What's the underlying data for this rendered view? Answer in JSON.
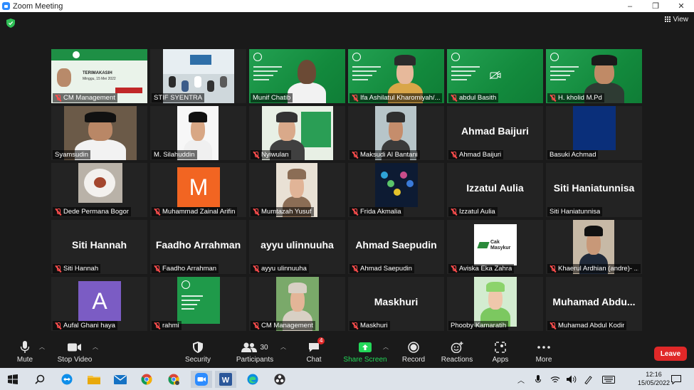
{
  "window": {
    "title": "Zoom Meeting",
    "min": "–",
    "max": "❐",
    "close": "✕"
  },
  "view_label": "View",
  "slide_text": {
    "title": "TERIMAKASIH",
    "date": "Minggu, 15 Mei 2022"
  },
  "participants": [
    {
      "name": "CM Management",
      "muted": true,
      "kind": "slide-cm",
      "active": true
    },
    {
      "name": "STIF SYENTRA",
      "muted": false,
      "kind": "room"
    },
    {
      "name": "Munif Chatib",
      "muted": false,
      "kind": "slide-person"
    },
    {
      "name": "Ifa Ashilatul Kharomiyah/...",
      "muted": true,
      "kind": "slide-person2"
    },
    {
      "name": "abdul Basith",
      "muted": true,
      "kind": "slide-camoff"
    },
    {
      "name": "H. kholid M.Pd",
      "muted": true,
      "kind": "slide-person3"
    },
    {
      "name": "Syamsudin",
      "muted": false,
      "kind": "person-cap"
    },
    {
      "name": "M. Silahuddin",
      "muted": false,
      "kind": "person-white"
    },
    {
      "name": "Nyiwulan",
      "muted": true,
      "kind": "person-hijab-slide"
    },
    {
      "name": "Maksudi Al Bantani",
      "muted": true,
      "kind": "person-outdoor"
    },
    {
      "name": "Ahmad Baijuri",
      "muted": true,
      "kind": "name",
      "display": "Ahmad Baijuri"
    },
    {
      "name": "Basuki Achmad",
      "muted": false,
      "kind": "blue-square"
    },
    {
      "name": "Dede Permana Bogor",
      "muted": true,
      "kind": "plate"
    },
    {
      "name": "Muhammad Zainal Arifin",
      "muted": true,
      "kind": "letter",
      "letter": "M",
      "color": "#f26522"
    },
    {
      "name": "Mumtazah Yusuf",
      "muted": true,
      "kind": "person-hijab"
    },
    {
      "name": "Frida Akmalia",
      "muted": true,
      "kind": "space"
    },
    {
      "name": "Izzatul Aulia",
      "muted": true,
      "kind": "name",
      "display": "Izzatul Aulia"
    },
    {
      "name": "Siti Haniatunnisa",
      "muted": false,
      "kind": "name",
      "display": "Siti Haniatunnisa"
    },
    {
      "name": "Siti Hannah",
      "muted": true,
      "kind": "name",
      "display": "Siti Hannah"
    },
    {
      "name": "Faadho Arrahman",
      "muted": true,
      "kind": "name",
      "display": "Faadho Arrahman"
    },
    {
      "name": "ayyu ulinnuuha",
      "muted": true,
      "kind": "name",
      "display": "ayyu ulinnuuha"
    },
    {
      "name": "Ahmad Saepudin",
      "muted": true,
      "kind": "name",
      "display": "Ahmad Saepudin"
    },
    {
      "name": "Aviska Eka Zahra",
      "muted": true,
      "kind": "logo",
      "logo_text": "Cak Masykur"
    },
    {
      "name": "Khaerul Ardhian (andre)- ...",
      "muted": true,
      "kind": "person-peci"
    },
    {
      "name": "Aufal Ghani haya",
      "muted": true,
      "kind": "letter",
      "letter": "A",
      "color": "#7b5cc4"
    },
    {
      "name": "rahmi",
      "muted": true,
      "kind": "slide-doc"
    },
    {
      "name": "CM Management",
      "muted": true,
      "kind": "person-hijab2"
    },
    {
      "name": "Maskhuri",
      "muted": true,
      "kind": "name",
      "display": "Maskhuri"
    },
    {
      "name": "Phooby Kamaratih",
      "muted": false,
      "kind": "person-green"
    },
    {
      "name": "Muhamad Abdul Kodir",
      "muted": true,
      "kind": "name",
      "display": "Muhamad  Abdu..."
    }
  ],
  "toolbar": {
    "mute": "Mute",
    "stop_video": "Stop Video",
    "security": "Security",
    "participants": "Participants",
    "participants_count": "30",
    "chat": "Chat",
    "chat_badge": "4",
    "share_screen": "Share Screen",
    "record": "Record",
    "reactions": "Reactions",
    "apps": "Apps",
    "more": "More",
    "leave": "Leave"
  },
  "colors": {
    "share_green": "#23d959",
    "leave_red": "#e02828",
    "active_border": "#e6e63c"
  },
  "taskbar": {
    "time": "12:16",
    "date": "15/05/2022",
    "apps": [
      "windows-start",
      "search",
      "teamviewer",
      "file-explorer",
      "mail",
      "chrome",
      "chrome-alt",
      "zoom",
      "word",
      "edge",
      "obs"
    ]
  }
}
